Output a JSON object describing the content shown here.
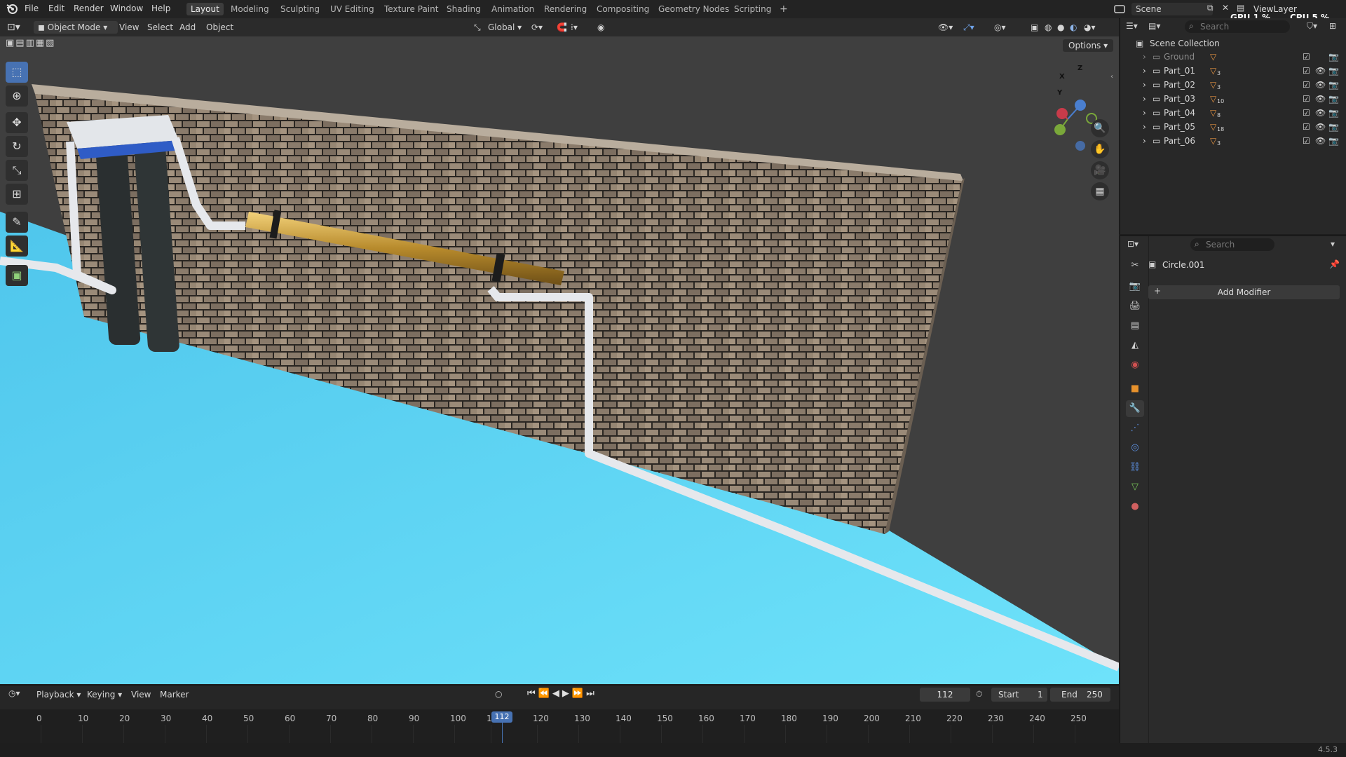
{
  "menu": [
    "File",
    "Edit",
    "Render",
    "Window",
    "Help"
  ],
  "workspaces": [
    "Layout",
    "Modeling",
    "Sculpting",
    "UV Editing",
    "Texture Paint",
    "Shading",
    "Animation",
    "Rendering",
    "Compositing",
    "Geometry Nodes",
    "Scripting",
    "+"
  ],
  "active_workspace": "Layout",
  "scene": {
    "label": "Scene",
    "view_layer": "ViewLayer"
  },
  "stats": {
    "gpu": "GPU 1 %",
    "cpu": "CPU 5 %"
  },
  "viewport_header": {
    "mode": "Object Mode",
    "menus": [
      "View",
      "Select",
      "Add",
      "Object"
    ],
    "orientation": "Global",
    "options": "Options"
  },
  "toolbar_icons": [
    "select-box-icon",
    "cursor-icon",
    "move-icon",
    "rotate-icon",
    "scale-icon",
    "transform-icon",
    "annotate-icon",
    "measure-icon",
    "add-cube-icon"
  ],
  "nav_gizmo": {
    "x": "X",
    "y": "Y",
    "z": "Z"
  },
  "outliner": {
    "search_placeholder": "Search",
    "collection": "Scene Collection",
    "items": [
      {
        "name": "Ground",
        "modifier_count": ""
      },
      {
        "name": "Part_01",
        "modifier_count": "3"
      },
      {
        "name": "Part_02",
        "modifier_count": "3"
      },
      {
        "name": "Part_03",
        "modifier_count": "10"
      },
      {
        "name": "Part_04",
        "modifier_count": "8"
      },
      {
        "name": "Part_05",
        "modifier_count": "18"
      },
      {
        "name": "Part_06",
        "modifier_count": "3"
      }
    ]
  },
  "properties": {
    "search_placeholder": "Search",
    "object_name": "Circle.001",
    "add_modifier": "Add Modifier",
    "add_modifier_plus": "+"
  },
  "timeline": {
    "menus": [
      "Playback",
      "Keying",
      "View",
      "Marker"
    ],
    "current_frame": "112",
    "start_label": "Start",
    "start": "1",
    "end_label": "End",
    "end": "250",
    "ticks": [
      "0",
      "10",
      "20",
      "30",
      "40",
      "50",
      "60",
      "70",
      "80",
      "90",
      "100",
      "1",
      "120",
      "130",
      "140",
      "150",
      "160",
      "170",
      "180",
      "190",
      "200",
      "210",
      "220",
      "230",
      "240",
      "250"
    ],
    "playhead": "112"
  },
  "version": "4.5.3",
  "colors": {
    "accent": "#4772b3",
    "floor": "#5fd8f5",
    "brick": "#8c7b68",
    "brass": "#c89a3a",
    "pipe": "#e6e8ec"
  }
}
